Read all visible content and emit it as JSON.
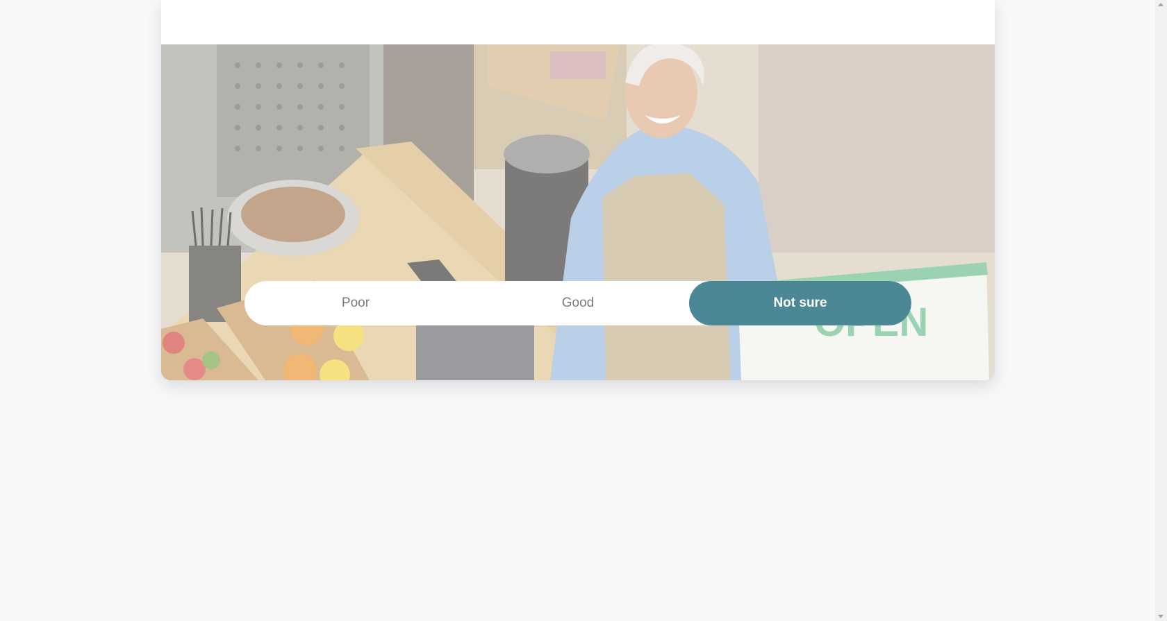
{
  "hero": {
    "image": "shop-owner-holding-open-sign",
    "sign_text": "OPEN"
  },
  "rating_options": [
    {
      "label": "Poor",
      "selected": false
    },
    {
      "label": "Good",
      "selected": false
    },
    {
      "label": "Not sure",
      "selected": true
    }
  ],
  "colors": {
    "selected_option": "#4b8794",
    "page_background": "#f7f8fa"
  }
}
